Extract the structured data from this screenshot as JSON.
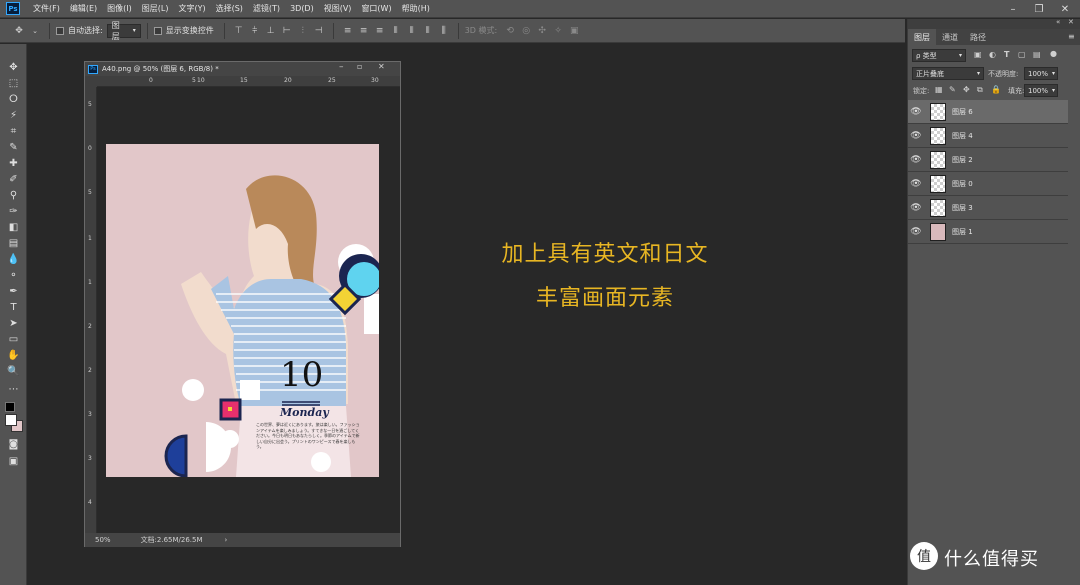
{
  "menu": [
    "文件(F)",
    "编辑(E)",
    "图像(I)",
    "图层(L)",
    "文字(Y)",
    "选择(S)",
    "滤镜(T)",
    "3D(D)",
    "视图(V)",
    "窗口(W)",
    "帮助(H)"
  ],
  "options": {
    "auto_select": "自动选择:",
    "auto_select_value": "图层",
    "show_transform": "显示变换控件",
    "mode_3d": "3D 模式:"
  },
  "doc": {
    "title": "A40.png @ 50% (图层 6, RGB/8) *",
    "zoom": "50%",
    "file_info": "文档:2.65M/26.5M",
    "ruler_top": [
      "0",
      "5",
      "10",
      "15",
      "20",
      "25",
      "30"
    ],
    "ruler_left": [
      "5",
      "0",
      "5",
      "1",
      "1",
      "2",
      "2",
      "3",
      "3",
      "4"
    ]
  },
  "artwork": {
    "big_number": "10",
    "day": "Monday",
    "body_text": "この世界、夢は近くにあります。旅は楽しい。ファッションアイテムを楽しみましょう。すてきな一日を過ごしてください。今日も明日もあなたらしく。季節のアイテムで新しい自分に出会う。プリントのワンピースで春を楽しもう。"
  },
  "caption": {
    "line1": "加上具有英文和日文",
    "line2": "丰富画面元素"
  },
  "panels": {
    "tabs": [
      "图层",
      "通道",
      "路径"
    ],
    "filter_kind": "ρ 类型",
    "blend_mode": "正片叠底",
    "opacity_label": "不透明度:",
    "opacity_value": "100%",
    "lock_label": "锁定:",
    "fill_label": "填充:",
    "fill_value": "100%",
    "layers": [
      {
        "name": "图层 6",
        "selected": true
      },
      {
        "name": "图层 4",
        "selected": false
      },
      {
        "name": "图层 2",
        "selected": false
      },
      {
        "name": "图层 0",
        "selected": false
      },
      {
        "name": "图层 3",
        "selected": false
      },
      {
        "name": "图层 1",
        "selected": false
      }
    ]
  },
  "watermark": "值 什么值得买",
  "colors": {
    "caption": "#e8b623",
    "artboard_bg": "#e2c7c9",
    "shape_navy": "#1b2550",
    "shape_cyan": "#5fd3ef",
    "shape_yellow": "#f3d335",
    "shape_pink": "#e6306d",
    "shape_blue": "#1e3f9a"
  }
}
